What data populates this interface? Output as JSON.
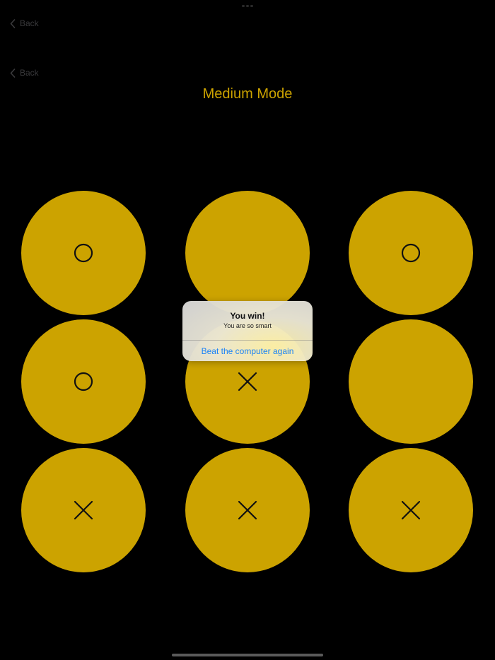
{
  "nav": {
    "back_label_1": "Back",
    "back_label_2": "Back"
  },
  "title": "Medium Mode",
  "board": {
    "cells": [
      {
        "row": 1,
        "col": 1,
        "mark": "O"
      },
      {
        "row": 1,
        "col": 2,
        "mark": ""
      },
      {
        "row": 1,
        "col": 3,
        "mark": "O"
      },
      {
        "row": 2,
        "col": 1,
        "mark": "O"
      },
      {
        "row": 2,
        "col": 2,
        "mark": "X"
      },
      {
        "row": 2,
        "col": 3,
        "mark": ""
      },
      {
        "row": 3,
        "col": 1,
        "mark": "X"
      },
      {
        "row": 3,
        "col": 2,
        "mark": "X"
      },
      {
        "row": 3,
        "col": 3,
        "mark": "X"
      }
    ]
  },
  "alert": {
    "title": "You win!",
    "message": "You are so smart",
    "action_label": "Beat the computer again"
  },
  "colors": {
    "background": "#000000",
    "cell": "#cca300",
    "title": "#cca300",
    "mark": "#111111",
    "alert_action": "#1a82f7"
  }
}
